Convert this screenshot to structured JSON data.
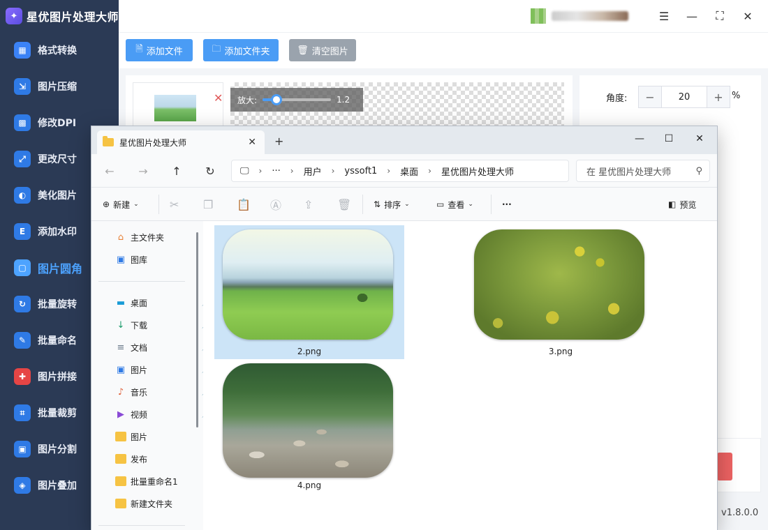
{
  "app": {
    "title": "星优图片处理大师",
    "version": "v1.8.0.0"
  },
  "sidebar": {
    "items": [
      {
        "label": "格式转换",
        "icon": "format-convert-icon",
        "color": "#3b82f6"
      },
      {
        "label": "图片压缩",
        "icon": "compress-icon",
        "color": "#2f7ae5"
      },
      {
        "label": "修改DPI",
        "icon": "dpi-icon",
        "color": "#2f7ae5"
      },
      {
        "label": "更改尺寸",
        "icon": "resize-icon",
        "color": "#2f7ae5"
      },
      {
        "label": "美化图片",
        "icon": "beautify-icon",
        "color": "#2f7ae5"
      },
      {
        "label": "添加水印",
        "icon": "watermark-icon",
        "color": "#2f7ae5"
      },
      {
        "label": "图片圆角",
        "icon": "rounded-corner-icon",
        "color": "#4da3ff",
        "active": true
      },
      {
        "label": "批量旋转",
        "icon": "rotate-icon",
        "color": "#2f7ae5"
      },
      {
        "label": "批量命名",
        "icon": "rename-icon",
        "color": "#2f7ae5"
      },
      {
        "label": "图片拼接",
        "icon": "stitch-icon",
        "color": "#e64545"
      },
      {
        "label": "批量裁剪",
        "icon": "crop-icon",
        "color": "#2f7ae5"
      },
      {
        "label": "图片分割",
        "icon": "split-icon",
        "color": "#2f7ae5"
      },
      {
        "label": "图片叠加",
        "icon": "overlay-icon",
        "color": "#2f7ae5"
      }
    ]
  },
  "toolbar": {
    "add_file": "添加文件",
    "add_folder": "添加文件夹",
    "clear": "清空图片"
  },
  "preview": {
    "zoom_label": "放大:",
    "zoom_value": "1.2",
    "zoom_fraction": 0.14
  },
  "settings": {
    "angle_label": "角度:",
    "angle_value": "20",
    "unit": "%"
  },
  "explorer": {
    "tab_title": "星优图片处理大师",
    "breadcrumb": [
      "用户",
      "yssoft1",
      "桌面",
      "星优图片处理大师"
    ],
    "search_placeholder": "在 星优图片处理大师",
    "commands": {
      "new": "新建",
      "sort": "排序",
      "view": "查看",
      "more": "···",
      "preview": "预览"
    },
    "nav_top": [
      {
        "label": "主文件夹",
        "icon": "home-icon"
      },
      {
        "label": "图库",
        "icon": "gallery-icon"
      }
    ],
    "nav_pinned": [
      {
        "label": "桌面",
        "icon": "desktop-icon"
      },
      {
        "label": "下载",
        "icon": "download-icon"
      },
      {
        "label": "文档",
        "icon": "document-icon"
      },
      {
        "label": "图片",
        "icon": "pictures-icon"
      },
      {
        "label": "音乐",
        "icon": "music-icon"
      },
      {
        "label": "视频",
        "icon": "video-icon"
      }
    ],
    "nav_folders": [
      "图片",
      "发布",
      "批量重命名1",
      "新建文件夹"
    ],
    "files": [
      {
        "name": "2.png",
        "selected": true
      },
      {
        "name": "3.png",
        "selected": false
      },
      {
        "name": "4.png",
        "selected": false
      }
    ]
  }
}
